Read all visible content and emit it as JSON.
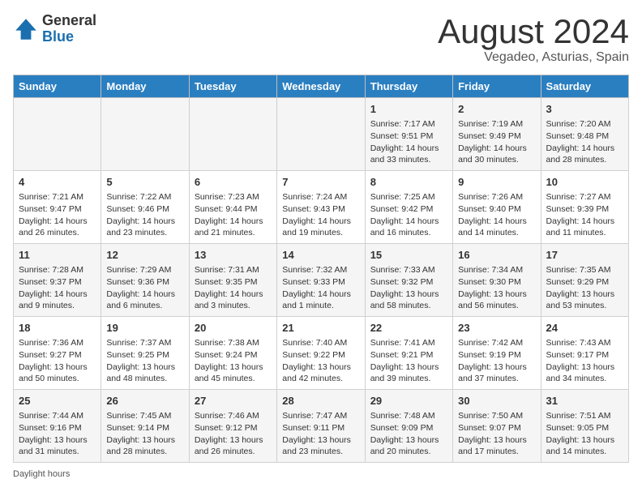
{
  "logo": {
    "general": "General",
    "blue": "Blue"
  },
  "title": {
    "month_year": "August 2024",
    "location": "Vegadeo, Asturias, Spain"
  },
  "days_of_week": [
    "Sunday",
    "Monday",
    "Tuesday",
    "Wednesday",
    "Thursday",
    "Friday",
    "Saturday"
  ],
  "weeks": [
    [
      {
        "day": "",
        "info": ""
      },
      {
        "day": "",
        "info": ""
      },
      {
        "day": "",
        "info": ""
      },
      {
        "day": "",
        "info": ""
      },
      {
        "day": "1",
        "info": "Sunrise: 7:17 AM\nSunset: 9:51 PM\nDaylight: 14 hours and 33 minutes."
      },
      {
        "day": "2",
        "info": "Sunrise: 7:19 AM\nSunset: 9:49 PM\nDaylight: 14 hours and 30 minutes."
      },
      {
        "day": "3",
        "info": "Sunrise: 7:20 AM\nSunset: 9:48 PM\nDaylight: 14 hours and 28 minutes."
      }
    ],
    [
      {
        "day": "4",
        "info": "Sunrise: 7:21 AM\nSunset: 9:47 PM\nDaylight: 14 hours and 26 minutes."
      },
      {
        "day": "5",
        "info": "Sunrise: 7:22 AM\nSunset: 9:46 PM\nDaylight: 14 hours and 23 minutes."
      },
      {
        "day": "6",
        "info": "Sunrise: 7:23 AM\nSunset: 9:44 PM\nDaylight: 14 hours and 21 minutes."
      },
      {
        "day": "7",
        "info": "Sunrise: 7:24 AM\nSunset: 9:43 PM\nDaylight: 14 hours and 19 minutes."
      },
      {
        "day": "8",
        "info": "Sunrise: 7:25 AM\nSunset: 9:42 PM\nDaylight: 14 hours and 16 minutes."
      },
      {
        "day": "9",
        "info": "Sunrise: 7:26 AM\nSunset: 9:40 PM\nDaylight: 14 hours and 14 minutes."
      },
      {
        "day": "10",
        "info": "Sunrise: 7:27 AM\nSunset: 9:39 PM\nDaylight: 14 hours and 11 minutes."
      }
    ],
    [
      {
        "day": "11",
        "info": "Sunrise: 7:28 AM\nSunset: 9:37 PM\nDaylight: 14 hours and 9 minutes."
      },
      {
        "day": "12",
        "info": "Sunrise: 7:29 AM\nSunset: 9:36 PM\nDaylight: 14 hours and 6 minutes."
      },
      {
        "day": "13",
        "info": "Sunrise: 7:31 AM\nSunset: 9:35 PM\nDaylight: 14 hours and 3 minutes."
      },
      {
        "day": "14",
        "info": "Sunrise: 7:32 AM\nSunset: 9:33 PM\nDaylight: 14 hours and 1 minute."
      },
      {
        "day": "15",
        "info": "Sunrise: 7:33 AM\nSunset: 9:32 PM\nDaylight: 13 hours and 58 minutes."
      },
      {
        "day": "16",
        "info": "Sunrise: 7:34 AM\nSunset: 9:30 PM\nDaylight: 13 hours and 56 minutes."
      },
      {
        "day": "17",
        "info": "Sunrise: 7:35 AM\nSunset: 9:29 PM\nDaylight: 13 hours and 53 minutes."
      }
    ],
    [
      {
        "day": "18",
        "info": "Sunrise: 7:36 AM\nSunset: 9:27 PM\nDaylight: 13 hours and 50 minutes."
      },
      {
        "day": "19",
        "info": "Sunrise: 7:37 AM\nSunset: 9:25 PM\nDaylight: 13 hours and 48 minutes."
      },
      {
        "day": "20",
        "info": "Sunrise: 7:38 AM\nSunset: 9:24 PM\nDaylight: 13 hours and 45 minutes."
      },
      {
        "day": "21",
        "info": "Sunrise: 7:40 AM\nSunset: 9:22 PM\nDaylight: 13 hours and 42 minutes."
      },
      {
        "day": "22",
        "info": "Sunrise: 7:41 AM\nSunset: 9:21 PM\nDaylight: 13 hours and 39 minutes."
      },
      {
        "day": "23",
        "info": "Sunrise: 7:42 AM\nSunset: 9:19 PM\nDaylight: 13 hours and 37 minutes."
      },
      {
        "day": "24",
        "info": "Sunrise: 7:43 AM\nSunset: 9:17 PM\nDaylight: 13 hours and 34 minutes."
      }
    ],
    [
      {
        "day": "25",
        "info": "Sunrise: 7:44 AM\nSunset: 9:16 PM\nDaylight: 13 hours and 31 minutes."
      },
      {
        "day": "26",
        "info": "Sunrise: 7:45 AM\nSunset: 9:14 PM\nDaylight: 13 hours and 28 minutes."
      },
      {
        "day": "27",
        "info": "Sunrise: 7:46 AM\nSunset: 9:12 PM\nDaylight: 13 hours and 26 minutes."
      },
      {
        "day": "28",
        "info": "Sunrise: 7:47 AM\nSunset: 9:11 PM\nDaylight: 13 hours and 23 minutes."
      },
      {
        "day": "29",
        "info": "Sunrise: 7:48 AM\nSunset: 9:09 PM\nDaylight: 13 hours and 20 minutes."
      },
      {
        "day": "30",
        "info": "Sunrise: 7:50 AM\nSunset: 9:07 PM\nDaylight: 13 hours and 17 minutes."
      },
      {
        "day": "31",
        "info": "Sunrise: 7:51 AM\nSunset: 9:05 PM\nDaylight: 13 hours and 14 minutes."
      }
    ]
  ],
  "footer": {
    "note": "Daylight hours"
  }
}
